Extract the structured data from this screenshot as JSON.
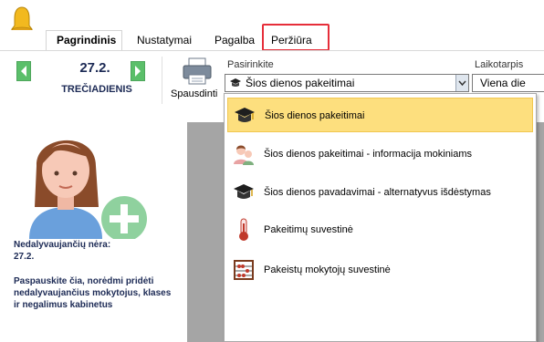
{
  "ribbon_tabs": {
    "home": "Pagrindinis",
    "settings": "Nustatymai",
    "help": "Pagalba",
    "view": "Peržiūra"
  },
  "navigator": {
    "date": "27.2.",
    "weekday": "TREČIADIENIS"
  },
  "print": {
    "label": "Spausdinti"
  },
  "select_group": {
    "label": "Pasirinkite",
    "selected": "Šios dienos pakeitimai"
  },
  "period_group": {
    "label": "Laikotarpis",
    "selected": "Viena die"
  },
  "left_panel": {
    "absent_line1": "Nedalyvaujančių nėra:",
    "absent_line2": "27.2.",
    "hint": "Paspauskite čia, norėdmi pridėti nedalyvaujančius mokytojus, klases ir negalimus kabinetus"
  },
  "dropdown": {
    "items": [
      {
        "label": "Šios dienos pakeitimai",
        "icon": "graduation-cap-icon"
      },
      {
        "label": "Šios dienos pakeitimai - informacija mokiniams",
        "icon": "students-icon"
      },
      {
        "label": "Šios dienos pavadavimai - alternatyvus išdėstymas",
        "icon": "graduation-cap-icon"
      },
      {
        "label": "Pakeitimų suvestinė",
        "icon": "thermometer-icon"
      },
      {
        "label": "Pakeistų mokytojų suvestinė",
        "icon": "abacus-icon"
      }
    ]
  },
  "colors": {
    "selected_item": "#fddf7e",
    "highlight_border": "#e62e3a",
    "nav_green": "#5bbf6a",
    "text_navy": "#1c2a55"
  }
}
